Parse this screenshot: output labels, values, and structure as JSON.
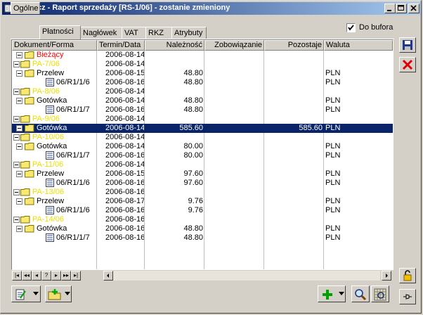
{
  "window": {
    "title": "Spinacz - Raport sprzedaży [RS-1/06] - zostanie zmieniony"
  },
  "tabs": [
    {
      "label": "Ogólne"
    },
    {
      "label": "Płatności"
    },
    {
      "label": "Nagłówek"
    },
    {
      "label": "VAT"
    },
    {
      "label": "RKZ"
    },
    {
      "label": "Atrybuty"
    }
  ],
  "active_tab": "Płatności",
  "from_buffer": {
    "label": "Do bufora",
    "checked": true
  },
  "columns": [
    "Dokument/Forma",
    "Termin/Data",
    "Należność",
    "Zobowiązanie",
    "Pozostaje",
    "Waluta"
  ],
  "rows": [
    {
      "level": 1,
      "icon": "folder",
      "label": "Bieżący",
      "color": "#ff0000",
      "date": "2006-08-14",
      "due": "",
      "liab": "",
      "rem": "",
      "cur": ""
    },
    {
      "level": 0,
      "icon": "folder",
      "label": "PA-7/06",
      "color": "#e8e000",
      "date": "2006-08-14",
      "due": "",
      "liab": "",
      "rem": "",
      "cur": ""
    },
    {
      "level": 1,
      "icon": "folder",
      "label": "Przelew",
      "color": "#000000",
      "date": "2006-08-15",
      "due": "48.80",
      "liab": "",
      "rem": "",
      "cur": "PLN"
    },
    {
      "level": 2,
      "icon": "doc",
      "label": "06/R1/1/6",
      "color": "#000000",
      "date": "2006-08-16",
      "due": "48.80",
      "liab": "",
      "rem": "",
      "cur": "PLN"
    },
    {
      "level": 0,
      "icon": "folder",
      "label": "PA-8/06",
      "color": "#e8e000",
      "date": "2006-08-14",
      "due": "",
      "liab": "",
      "rem": "",
      "cur": ""
    },
    {
      "level": 1,
      "icon": "folder",
      "label": "Gotówka",
      "color": "#000000",
      "date": "2006-08-14",
      "due": "48.80",
      "liab": "",
      "rem": "",
      "cur": "PLN"
    },
    {
      "level": 2,
      "icon": "doc",
      "label": "06/R1/1/7",
      "color": "#000000",
      "date": "2006-08-16",
      "due": "48.80",
      "liab": "",
      "rem": "",
      "cur": "PLN"
    },
    {
      "level": 0,
      "icon": "folder",
      "label": "PA-9/06",
      "color": "#e8e000",
      "date": "2006-08-14",
      "due": "",
      "liab": "",
      "rem": "",
      "cur": ""
    },
    {
      "level": 1,
      "icon": "folder",
      "label": "Gotówka",
      "color": "#ffffff",
      "date": "2006-08-14",
      "due": "585.60",
      "liab": "",
      "rem": "585.60",
      "cur": "PLN",
      "selected": true
    },
    {
      "level": 0,
      "icon": "folder",
      "label": "PA-10/06",
      "color": "#e8e000",
      "date": "2006-08-14",
      "due": "",
      "liab": "",
      "rem": "",
      "cur": ""
    },
    {
      "level": 1,
      "icon": "folder",
      "label": "Gotówka",
      "color": "#000000",
      "date": "2006-08-14",
      "due": "80.00",
      "liab": "",
      "rem": "",
      "cur": "PLN"
    },
    {
      "level": 2,
      "icon": "doc",
      "label": "06/R1/1/7",
      "color": "#000000",
      "date": "2006-08-16",
      "due": "80.00",
      "liab": "",
      "rem": "",
      "cur": "PLN"
    },
    {
      "level": 0,
      "icon": "folder",
      "label": "PA-11/06",
      "color": "#e8e000",
      "date": "2006-08-14",
      "due": "",
      "liab": "",
      "rem": "",
      "cur": ""
    },
    {
      "level": 1,
      "icon": "folder",
      "label": "Przelew",
      "color": "#000000",
      "date": "2006-08-15",
      "due": "97.60",
      "liab": "",
      "rem": "",
      "cur": "PLN"
    },
    {
      "level": 2,
      "icon": "doc",
      "label": "06/R1/1/6",
      "color": "#000000",
      "date": "2006-08-16",
      "due": "97.60",
      "liab": "",
      "rem": "",
      "cur": "PLN"
    },
    {
      "level": 0,
      "icon": "folder",
      "label": "PA-13/06",
      "color": "#e8e000",
      "date": "2006-08-16",
      "due": "",
      "liab": "",
      "rem": "",
      "cur": ""
    },
    {
      "level": 1,
      "icon": "folder",
      "label": "Przelew",
      "color": "#000000",
      "date": "2006-08-17",
      "due": "9.76",
      "liab": "",
      "rem": "",
      "cur": "PLN"
    },
    {
      "level": 2,
      "icon": "doc",
      "label": "06/R1/1/6",
      "color": "#000000",
      "date": "2006-08-16",
      "due": "9.76",
      "liab": "",
      "rem": "",
      "cur": "PLN"
    },
    {
      "level": 0,
      "icon": "folder",
      "label": "PA-14/06",
      "color": "#e8e000",
      "date": "2006-08-16",
      "due": "",
      "liab": "",
      "rem": "",
      "cur": ""
    },
    {
      "level": 1,
      "icon": "folder",
      "label": "Gotówka",
      "color": "#000000",
      "date": "2006-08-16",
      "due": "48.80",
      "liab": "",
      "rem": "",
      "cur": "PLN"
    },
    {
      "level": 2,
      "icon": "doc",
      "label": "06/R1/1/7",
      "color": "#000000",
      "date": "2006-08-16",
      "due": "48.80",
      "liab": "",
      "rem": "",
      "cur": "PLN"
    }
  ],
  "colors": {
    "selection": "#0a246a",
    "accent_title": "#0a246a"
  }
}
